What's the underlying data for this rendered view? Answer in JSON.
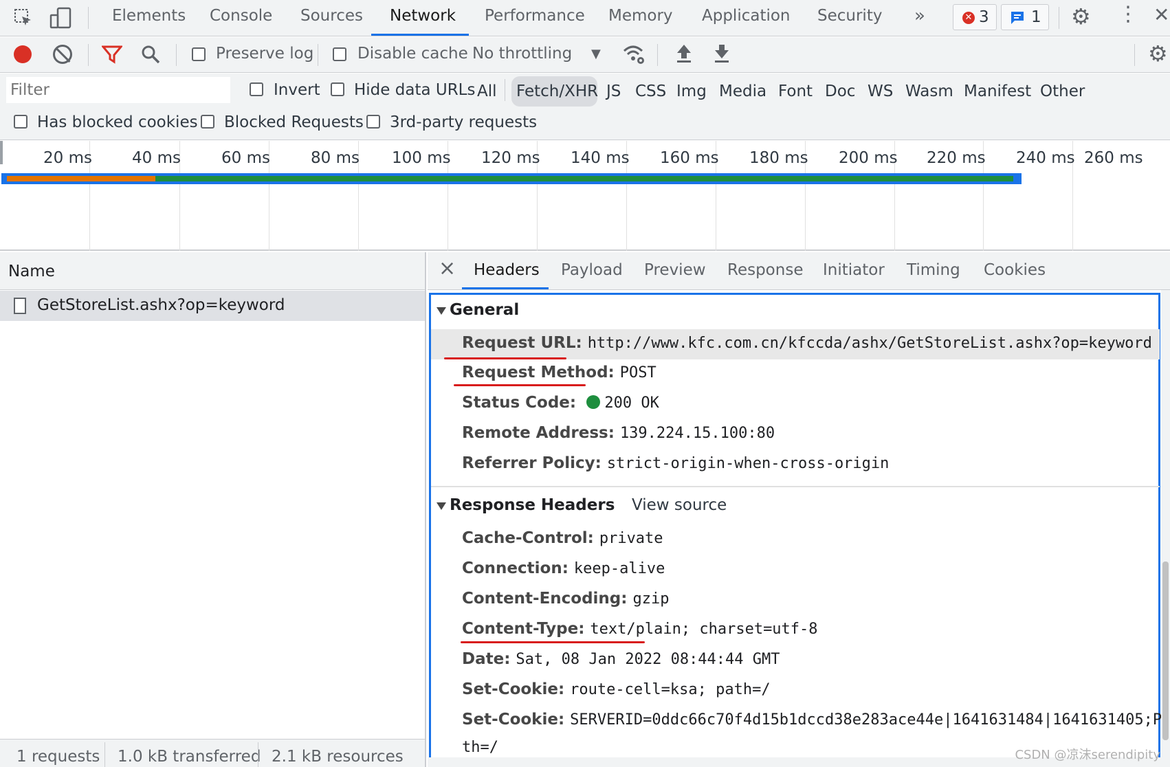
{
  "tabs": [
    "Elements",
    "Console",
    "Sources",
    "Network",
    "Performance",
    "Memory",
    "Application",
    "Security"
  ],
  "active_tab": "Network",
  "badges": {
    "errors": "3",
    "messages": "1"
  },
  "toolbar": {
    "preserve_log": "Preserve log",
    "disable_cache": "Disable cache",
    "throttling": "No throttling"
  },
  "filter": {
    "placeholder": "Filter",
    "invert": "Invert",
    "hide_data_urls": "Hide data URLs",
    "types": [
      "All",
      "Fetch/XHR",
      "JS",
      "CSS",
      "Img",
      "Media",
      "Font",
      "Doc",
      "WS",
      "Wasm",
      "Manifest",
      "Other"
    ],
    "active_type": "Fetch/XHR",
    "has_blocked_cookies": "Has blocked cookies",
    "blocked_requests": "Blocked Requests",
    "third_party": "3rd-party requests"
  },
  "overview": {
    "ticks": [
      "20 ms",
      "40 ms",
      "60 ms",
      "80 ms",
      "100 ms",
      "120 ms",
      "140 ms",
      "160 ms",
      "180 ms",
      "200 ms",
      "220 ms",
      "240 ms",
      "260 ms"
    ],
    "colors": {
      "waiting": "#e37400",
      "download": "#1e8e3e",
      "outline": "#1a73e8"
    }
  },
  "list": {
    "header": "Name",
    "rows": [
      "GetStoreList.ashx?op=keyword"
    ],
    "status": [
      "1 requests",
      "1.0 kB transferred",
      "2.1 kB resources"
    ]
  },
  "detail": {
    "close": "×",
    "tabs": [
      "Headers",
      "Payload",
      "Preview",
      "Response",
      "Initiator",
      "Timing",
      "Cookies"
    ],
    "active_tab": "Headers",
    "general": {
      "title": "General",
      "rows": [
        {
          "key": "Request URL:",
          "value": "http://www.kfc.com.cn/kfccda/ashx/GetStoreList.ashx?op=keyword"
        },
        {
          "key": "Request Method:",
          "value": "POST"
        },
        {
          "key": "Status Code:",
          "value": "200 OK"
        },
        {
          "key": "Remote Address:",
          "value": "139.224.15.100:80"
        },
        {
          "key": "Referrer Policy:",
          "value": "strict-origin-when-cross-origin"
        }
      ]
    },
    "response": {
      "title": "Response Headers",
      "view_source": "View source",
      "rows": [
        {
          "key": "Cache-Control:",
          "value": "private"
        },
        {
          "key": "Connection:",
          "value": "keep-alive"
        },
        {
          "key": "Content-Encoding:",
          "value": "gzip"
        },
        {
          "key": "Content-Type:",
          "value": "text/plain; charset=utf-8"
        },
        {
          "key": "Date:",
          "value": "Sat, 08 Jan 2022 08:44:44 GMT"
        },
        {
          "key": "Set-Cookie:",
          "value": "route-cell=ksa; path=/"
        },
        {
          "key": "Set-Cookie:",
          "value": "SERVERID=0ddc66c70f4d15b1dccd38e283ace44e|1641631484|1641631405;Pa"
        }
      ],
      "wrap": "th=/"
    }
  },
  "watermark": "CSDN @凉沫serendipity"
}
